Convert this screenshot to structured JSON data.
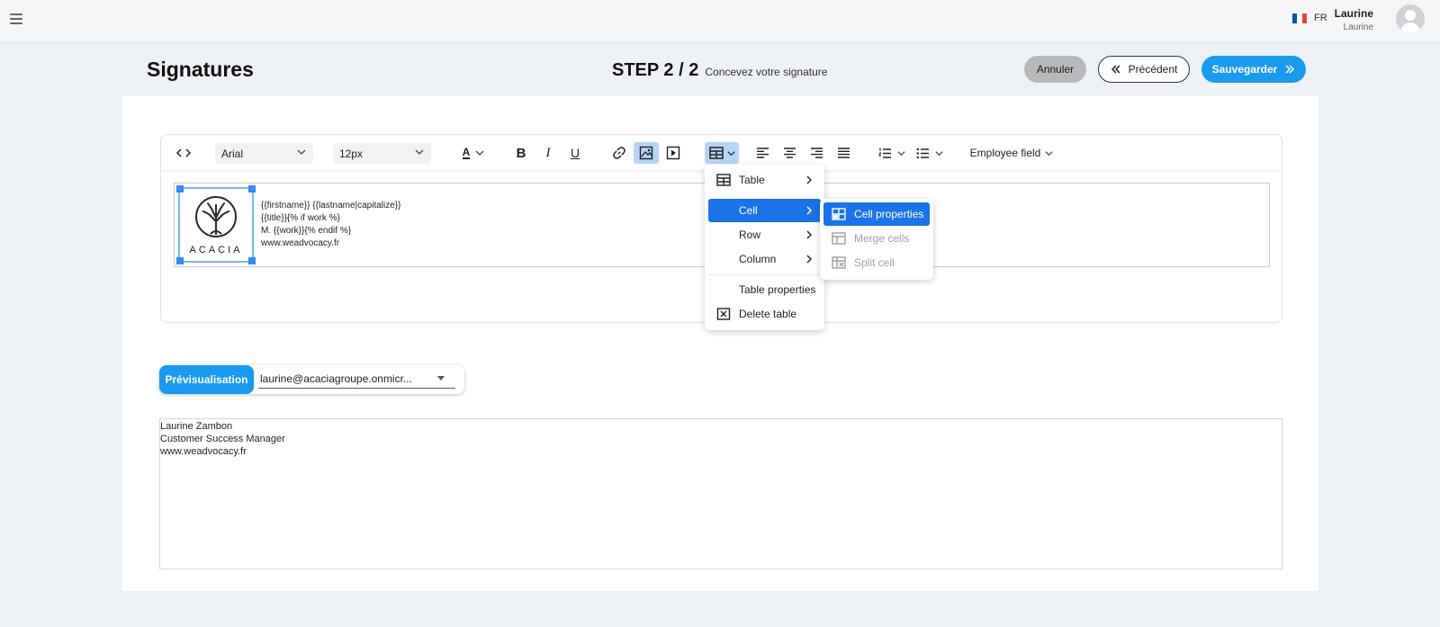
{
  "topbar": {
    "language": "FR",
    "user_name": "Laurine",
    "user_sub": "Laurine"
  },
  "header": {
    "title": "Signatures",
    "step": "STEP 2 / 2",
    "step_subtitle": "Concevez votre signature",
    "cancel_label": "Annuler",
    "previous_label": "Précédent",
    "save_label": "Sauvegarder"
  },
  "toolbar": {
    "font_family": "Arial",
    "font_size": "12px",
    "bold": "B",
    "italic": "I",
    "underline": "U",
    "font_color_letter": "A",
    "employee_field": "Employee field"
  },
  "table_menu": {
    "items": [
      "Table",
      "Cell",
      "Row",
      "Column",
      "Table properties",
      "Delete table"
    ]
  },
  "cell_submenu": {
    "items": [
      "Cell properties",
      "Merge cells",
      "Split cell"
    ]
  },
  "signature": {
    "logo_text": "ACACIA",
    "lines": [
      "{{firstname}} {{lastname|capitalize}}",
      "{{title}}{% if work %}",
      "M. {{work}}{% endif %}",
      "www.weadvocacy.fr"
    ]
  },
  "preview": {
    "button_label": "Prévisualisation",
    "selected_email": "laurine@acaciagroupe.onmicr...",
    "lines": [
      "Laurine Zambon",
      "Customer Success Manager",
      "www.weadvocacy.fr"
    ]
  },
  "colors": {
    "primary": "#1a9bf0",
    "menu_highlight": "#1a73e8",
    "toolbar_active": "#b7d4f7",
    "flag": [
      "#0055a4",
      "#ffffff",
      "#ef4135"
    ]
  }
}
